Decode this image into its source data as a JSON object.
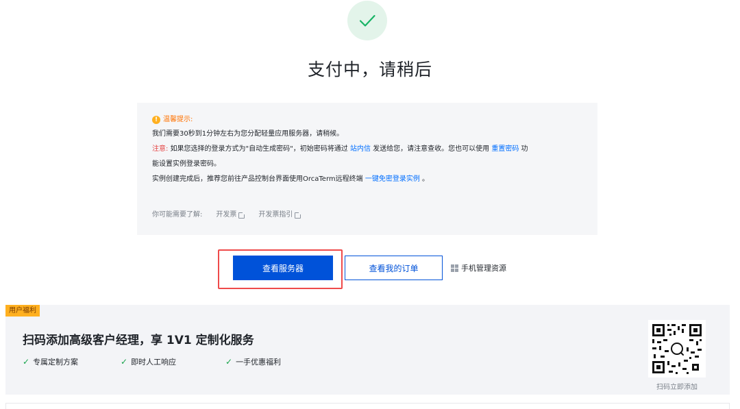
{
  "status": {
    "title": "支付中，请稍后",
    "icon": "check-icon",
    "accent": "#16b364"
  },
  "tips": {
    "heading": "温馨提示:",
    "line1": "我们需要30秒到1分钟左右为您分配轻量应用服务器，请稍候。",
    "note_label": "注意:",
    "note_text_a": "如果您选择的登录方式为\"自动生成密码\"，初始密码将通过",
    "note_link_inbox": "站内信",
    "note_text_b": "发送给您，请注意查收。您也可以使用",
    "note_link_reset": "重置密码",
    "note_text_c": "功",
    "line3": "能设置实例登录密码。",
    "line4_a": "实例创建完成后，推荐您前往产品控制台界面使用OrcaTerm远程终端",
    "line4_link": "一键免密登录实例",
    "line4_b": "。",
    "learn_label": "你可能需要了解:",
    "learn_links": [
      "开发票",
      "开发票指引"
    ]
  },
  "actions": {
    "view_servers": "查看服务器",
    "view_orders": "查看我的订单",
    "mobile_manage": "手机管理资源"
  },
  "benefit": {
    "tag": "用户福利",
    "title": "扫码添加高级客户经理，享 1V1 定制化服务",
    "features": [
      "专属定制方案",
      "即时人工响应",
      "一手优惠福利"
    ],
    "qr_caption": "扫码立即添加"
  },
  "colors": {
    "primary": "#0052d9",
    "warning": "#ff7200",
    "danger": "#e54545",
    "link": "#006eff",
    "highlight": "#ef4a4a"
  }
}
